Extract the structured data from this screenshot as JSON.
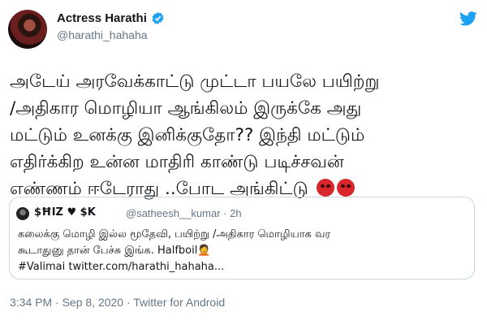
{
  "author": {
    "name": "Actress Harathi",
    "handle": "@harathi_hahaha",
    "verified": true
  },
  "tweet": {
    "lines": [
      "அடேய் அரவேக்காட்டு முட்டா பயலே பயிற்று",
      "/அதிகார மொழியா ஆங்கிலம் இருக்கே அது",
      "மட்டும் உனக்கு இனிக்குதோ?? இந்தி மட்டும்",
      "எதிர்க்கிற உன்ன மாதிரி காண்டு படிச்சவன்",
      "எண்ணம் ஈடேராது ..போட அங்கிட்டு"
    ],
    "emoji": [
      "angry-face",
      "angry-face"
    ]
  },
  "quoted": {
    "name": "$ĦIZ ♥ $K",
    "handle_time": "@satheesh__kumar · 2h",
    "lines": [
      "கலைக்கு மொழி இல்ல மூதேவி, பயிற்று /அதிகார மொழியாக வர",
      "கூடாதுனு தான் பேச்சு இங்க. Halfboil🤦",
      "#Valimai twitter.com/harathi_hahaha..."
    ]
  },
  "meta": {
    "timestamp": "3:34 PM · Sep 8, 2020 · Twitter for Android"
  },
  "colors": {
    "verified": "#1da1f2",
    "secondary_text": "#657786",
    "border": "#ccd6dd"
  }
}
